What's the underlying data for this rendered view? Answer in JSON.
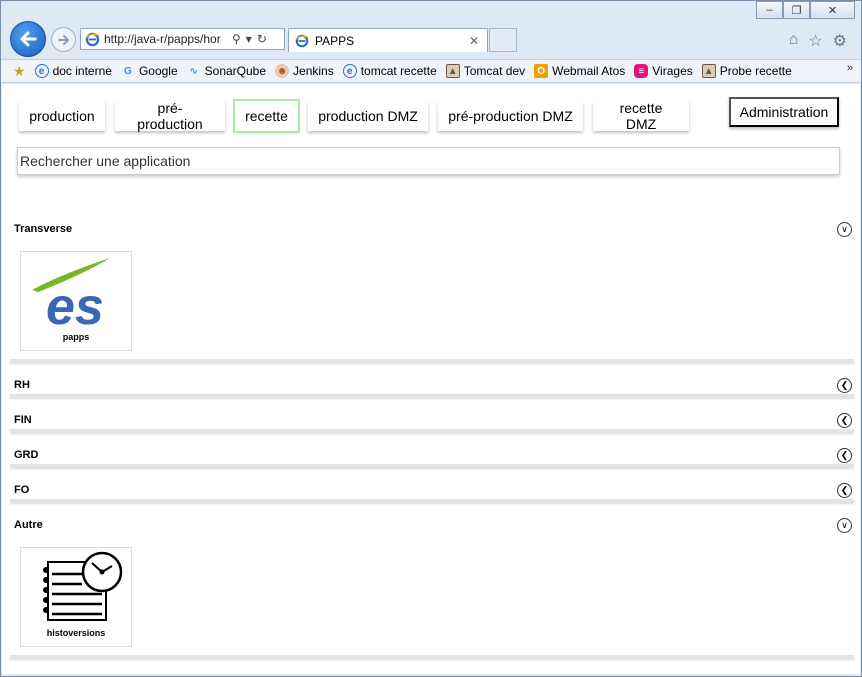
{
  "browser": {
    "address_url": "http://java-r/papps/hor",
    "tab_title": "PAPPS",
    "window_controls": [
      "minimize",
      "restore",
      "close"
    ]
  },
  "favorites": [
    {
      "label": "doc interne",
      "icon": "ie-page-icon",
      "color": "#2b6fc4"
    },
    {
      "label": "Google",
      "icon": "google-icon",
      "color": "#4285f4"
    },
    {
      "label": "SonarQube",
      "icon": "sonarqube-icon",
      "color": "#4e9bcd"
    },
    {
      "label": "Jenkins",
      "icon": "jenkins-icon",
      "color": "#b64a3a"
    },
    {
      "label": "tomcat recette",
      "icon": "ie-page-icon",
      "color": "#2b6fc4"
    },
    {
      "label": "Tomcat dev",
      "icon": "tomcat-icon",
      "color": "#6b5a3a"
    },
    {
      "label": "Webmail Atos",
      "icon": "webmail-icon",
      "color": "#f0a000"
    },
    {
      "label": "Virages",
      "icon": "virages-icon",
      "color": "#e0157a"
    },
    {
      "label": "Probe recette",
      "icon": "probe-icon",
      "color": "#6b5a3a"
    }
  ],
  "environments": [
    {
      "label": "production",
      "active": false
    },
    {
      "label": "pré-production",
      "active": false
    },
    {
      "label": "recette",
      "active": true
    },
    {
      "label": "production DMZ",
      "active": false
    },
    {
      "label": "pré-production DMZ",
      "active": false
    },
    {
      "label": "recette DMZ",
      "active": false
    }
  ],
  "admin_label": "Administration",
  "search": {
    "placeholder": "Rechercher une application"
  },
  "sections": [
    {
      "title": "Transverse",
      "expanded": true,
      "apps": [
        {
          "name": "papps"
        }
      ]
    },
    {
      "title": "RH",
      "expanded": false,
      "apps": []
    },
    {
      "title": "FIN",
      "expanded": false,
      "apps": []
    },
    {
      "title": "GRD",
      "expanded": false,
      "apps": []
    },
    {
      "title": "FO",
      "expanded": false,
      "apps": []
    },
    {
      "title": "Autre",
      "expanded": true,
      "apps": [
        {
          "name": "histoversions"
        }
      ]
    }
  ],
  "colors": {
    "active_env_border": "#aee8a6",
    "logo_blue": "#3a66b8",
    "logo_green": "#74b82a"
  }
}
